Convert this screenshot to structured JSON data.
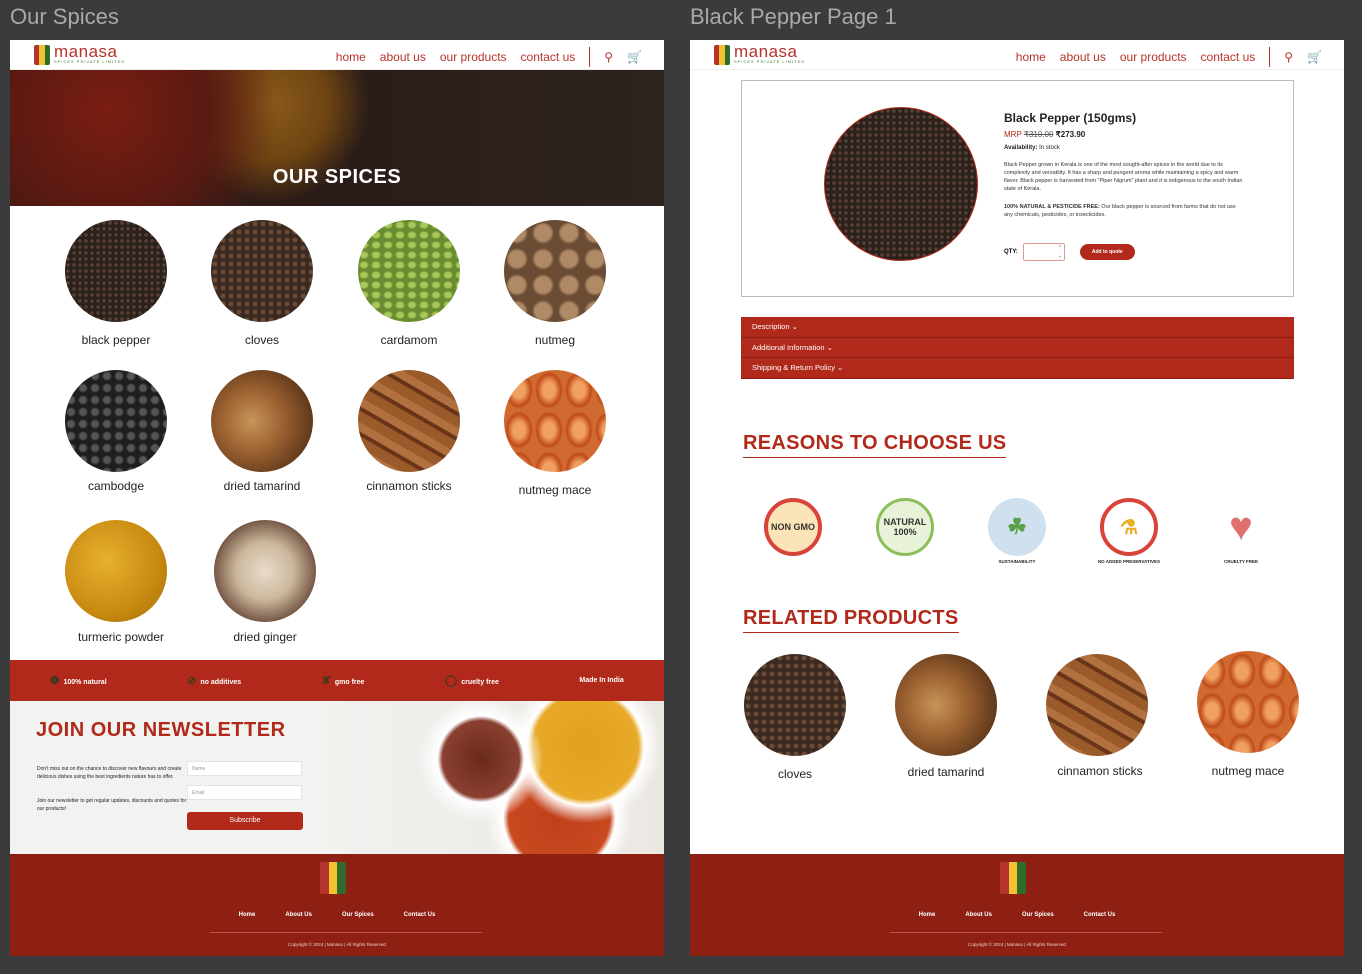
{
  "canvas": {
    "frames": [
      "Our Spices",
      "Black Pepper Page 1"
    ]
  },
  "brand": {
    "name": "manasa",
    "tagline": "SPICES PRIVATE LIMITED",
    "flag_colors": [
      "#b5332a",
      "#f2c230",
      "#2f6b2a"
    ]
  },
  "nav": {
    "items": [
      "home",
      "about us",
      "our products",
      "contact us"
    ],
    "search_icon": "search-icon",
    "cart_icon": "cart-icon"
  },
  "colors": {
    "primary": "#b0291a",
    "footer": "#8e2013"
  },
  "spices_page": {
    "hero_title": "OUR SPICES",
    "spices": [
      "black pepper",
      "cloves",
      "cardamom",
      "nutmeg",
      "cambodge",
      "dried tamarind",
      "cinnamon sticks",
      "nutmeg mace",
      "turmeric powder",
      "dried ginger"
    ],
    "features": [
      "100% natural",
      "no additives",
      "gmo free",
      "cruelty free",
      "Made In India"
    ],
    "newsletter": {
      "title": "JOIN OUR NEWSLETTER",
      "text1": "Don't miss out on the chance to discover new flavours and create delicious dishes using the best ingredients nature has to offer.",
      "text2": "Join our newsletter to get regular updates, discounts and quotes for our products!",
      "name_placeholder": "Name",
      "email_placeholder": "Email",
      "subscribe": "Subscribe"
    }
  },
  "footer": {
    "links": [
      "Home",
      "About Us",
      "Our Spices",
      "Contact Us"
    ],
    "copyright": "Copyright © 2024 | Manasa | All Rights Reserved"
  },
  "product_page": {
    "title": "Black Pepper (150gms)",
    "mrp_label": "MRP",
    "old_price": "₹310.00",
    "price": "₹273.90",
    "availability_label": "Availability:",
    "availability": "In stock",
    "description": "Black Pepper grown in Kerala is one of the most sought-after spices in the world due to its complexity and versatility. It has a sharp and pungent aroma while maintaining a spicy and warm flavor. Black pepper is harvested from \"Piper Nigrum\" plant and it is indigenous to the south Indian state of Kerala.",
    "natural_label": "100% NATURAL & PESTICIDE FREE:",
    "natural_text": "Our black pepper is sourced from farms that do not use any chemicals, pesticides, or insecticides.",
    "qty_label": "QTY:",
    "add_button": "Add to quote",
    "accordion": [
      "Description",
      "Additional Information",
      "Shipping & Return Policy"
    ],
    "reasons_title": "REASONS TO CHOOSE US",
    "reasons": [
      {
        "icon": "NON GMO",
        "label": ""
      },
      {
        "icon": "NATURAL 100%",
        "label": ""
      },
      {
        "icon": "",
        "label": "SUSTAINABILITY"
      },
      {
        "icon": "",
        "label": "NO ADDED PRESERVATIVES"
      },
      {
        "icon": "",
        "label": "CRUELTY FREE"
      }
    ],
    "related_title": "RELATED PRODUCTS",
    "related": [
      "cloves",
      "dried tamarind",
      "cinnamon sticks",
      "nutmeg mace"
    ]
  }
}
